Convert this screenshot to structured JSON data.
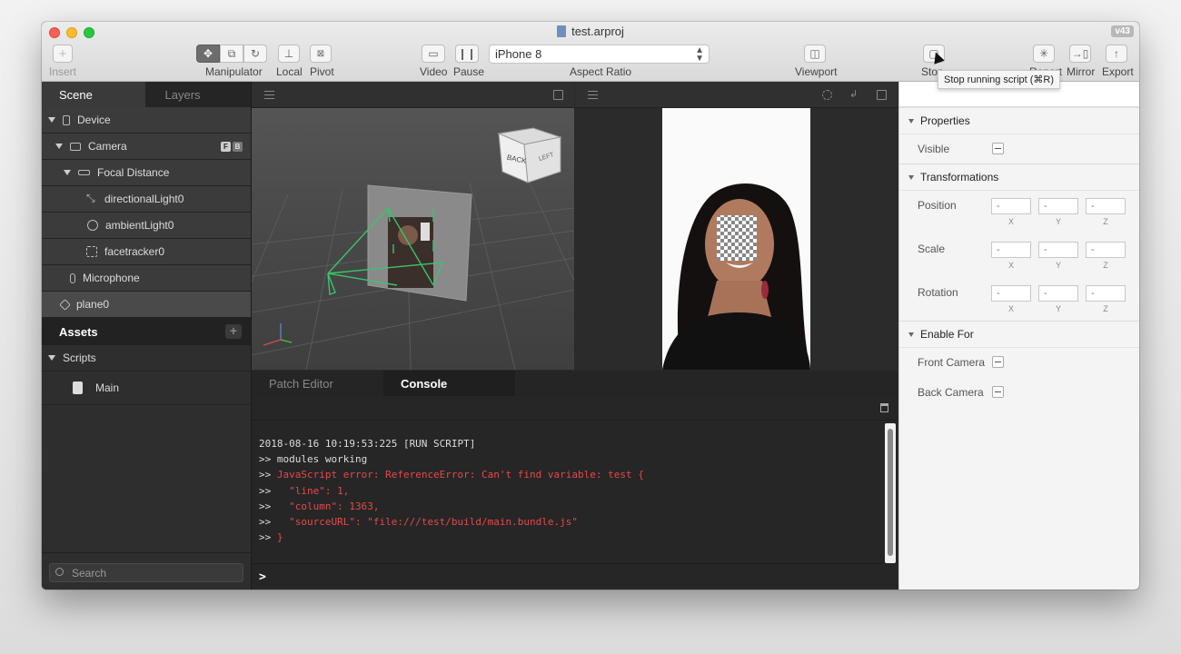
{
  "window": {
    "title": "test.arproj",
    "version": "v43"
  },
  "toolbar": {
    "insert_label": "Insert",
    "manipulator_label": "Manipulator",
    "local_label": "Local",
    "pivot_label": "Pivot",
    "video_label": "Video",
    "pause_label": "Pause",
    "device_select": "iPhone 8",
    "aspect_ratio_label": "Aspect Ratio",
    "viewport_label": "Viewport",
    "stop_label": "Stop",
    "report_label": "Report",
    "mirror_label": "Mirror",
    "export_label": "Export",
    "tooltip": "Stop running script (⌘R)"
  },
  "left_panel": {
    "tabs": [
      "Scene",
      "Layers"
    ],
    "tree": [
      {
        "label": "Device",
        "icon": "phone-icon"
      },
      {
        "label": "Camera",
        "icon": "camera-icon",
        "badges": [
          "F",
          "B"
        ]
      },
      {
        "label": "Focal Distance",
        "icon": "ruler-icon"
      },
      {
        "label": "directionalLight0",
        "icon": "directional-light-icon"
      },
      {
        "label": "ambientLight0",
        "icon": "ambient-light-icon"
      },
      {
        "label": "facetracker0",
        "icon": "face-tracker-icon"
      },
      {
        "label": "Microphone",
        "icon": "microphone-icon"
      },
      {
        "label": "plane0",
        "icon": "plane-icon"
      }
    ],
    "assets_label": "Assets",
    "scripts_label": "Scripts",
    "script_item": "Main",
    "search_placeholder": "Search"
  },
  "viewcube": {
    "back": "BACK",
    "left": "LEFT"
  },
  "bottom_panel": {
    "tabs": [
      "Patch Editor",
      "Console"
    ],
    "log": [
      "2018-08-16 10:19:53:225 [RUN SCRIPT]",
      ">> modules working",
      ">> ",
      ">> ",
      ">> ",
      ">> ",
      ">> "
    ],
    "errors": [
      "",
      "",
      "JavaScript error: ReferenceError: Can't find variable: test {",
      "  \"line\": 1,",
      "  \"column\": 1363,",
      "  \"sourceURL\": \"file:///test/build/main.bundle.js\"",
      "}"
    ],
    "prompt": ">"
  },
  "inspector": {
    "properties_label": "Properties",
    "visible_label": "Visible",
    "transformations_label": "Transformations",
    "position_label": "Position",
    "scale_label": "Scale",
    "rotation_label": "Rotation",
    "axes": [
      "X",
      "Y",
      "Z"
    ],
    "field_value": "-",
    "enable_for_label": "Enable For",
    "front_camera_label": "Front Camera",
    "back_camera_label": "Back Camera"
  },
  "colors": {
    "error": "#e5484d",
    "accent": "#6d6d6d"
  }
}
